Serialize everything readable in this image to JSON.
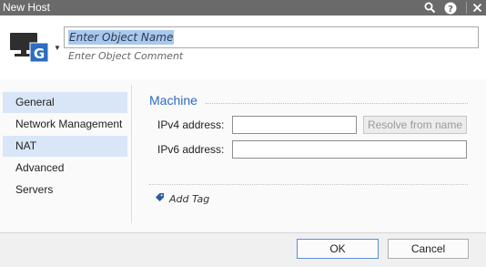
{
  "window": {
    "title": "New Host",
    "icons": [
      "search-icon",
      "help-icon",
      "close-icon"
    ]
  },
  "header": {
    "object_icon": "host-monitor-icon",
    "name_placeholder": "Enter Object Name",
    "comment_placeholder": "Enter Object Comment"
  },
  "sidebar": {
    "items": [
      {
        "label": "General",
        "selected": true
      },
      {
        "label": "Network Management",
        "selected": false
      },
      {
        "label": "NAT",
        "selected": false
      },
      {
        "label": "Advanced",
        "selected": false
      },
      {
        "label": "Servers",
        "selected": false
      }
    ]
  },
  "machine": {
    "title": "Machine",
    "ipv4_label": "IPv4 address:",
    "ipv4_value": "",
    "resolve_label": "Resolve from name",
    "ipv6_label": "IPv6 address:",
    "ipv6_value": ""
  },
  "tags": {
    "add_label": "Add Tag"
  },
  "footer": {
    "ok_label": "OK",
    "cancel_label": "Cancel"
  },
  "colors": {
    "titlebar": "#6a6a6a",
    "accent": "#2d6cc0",
    "selection": "#d8e6f7"
  }
}
